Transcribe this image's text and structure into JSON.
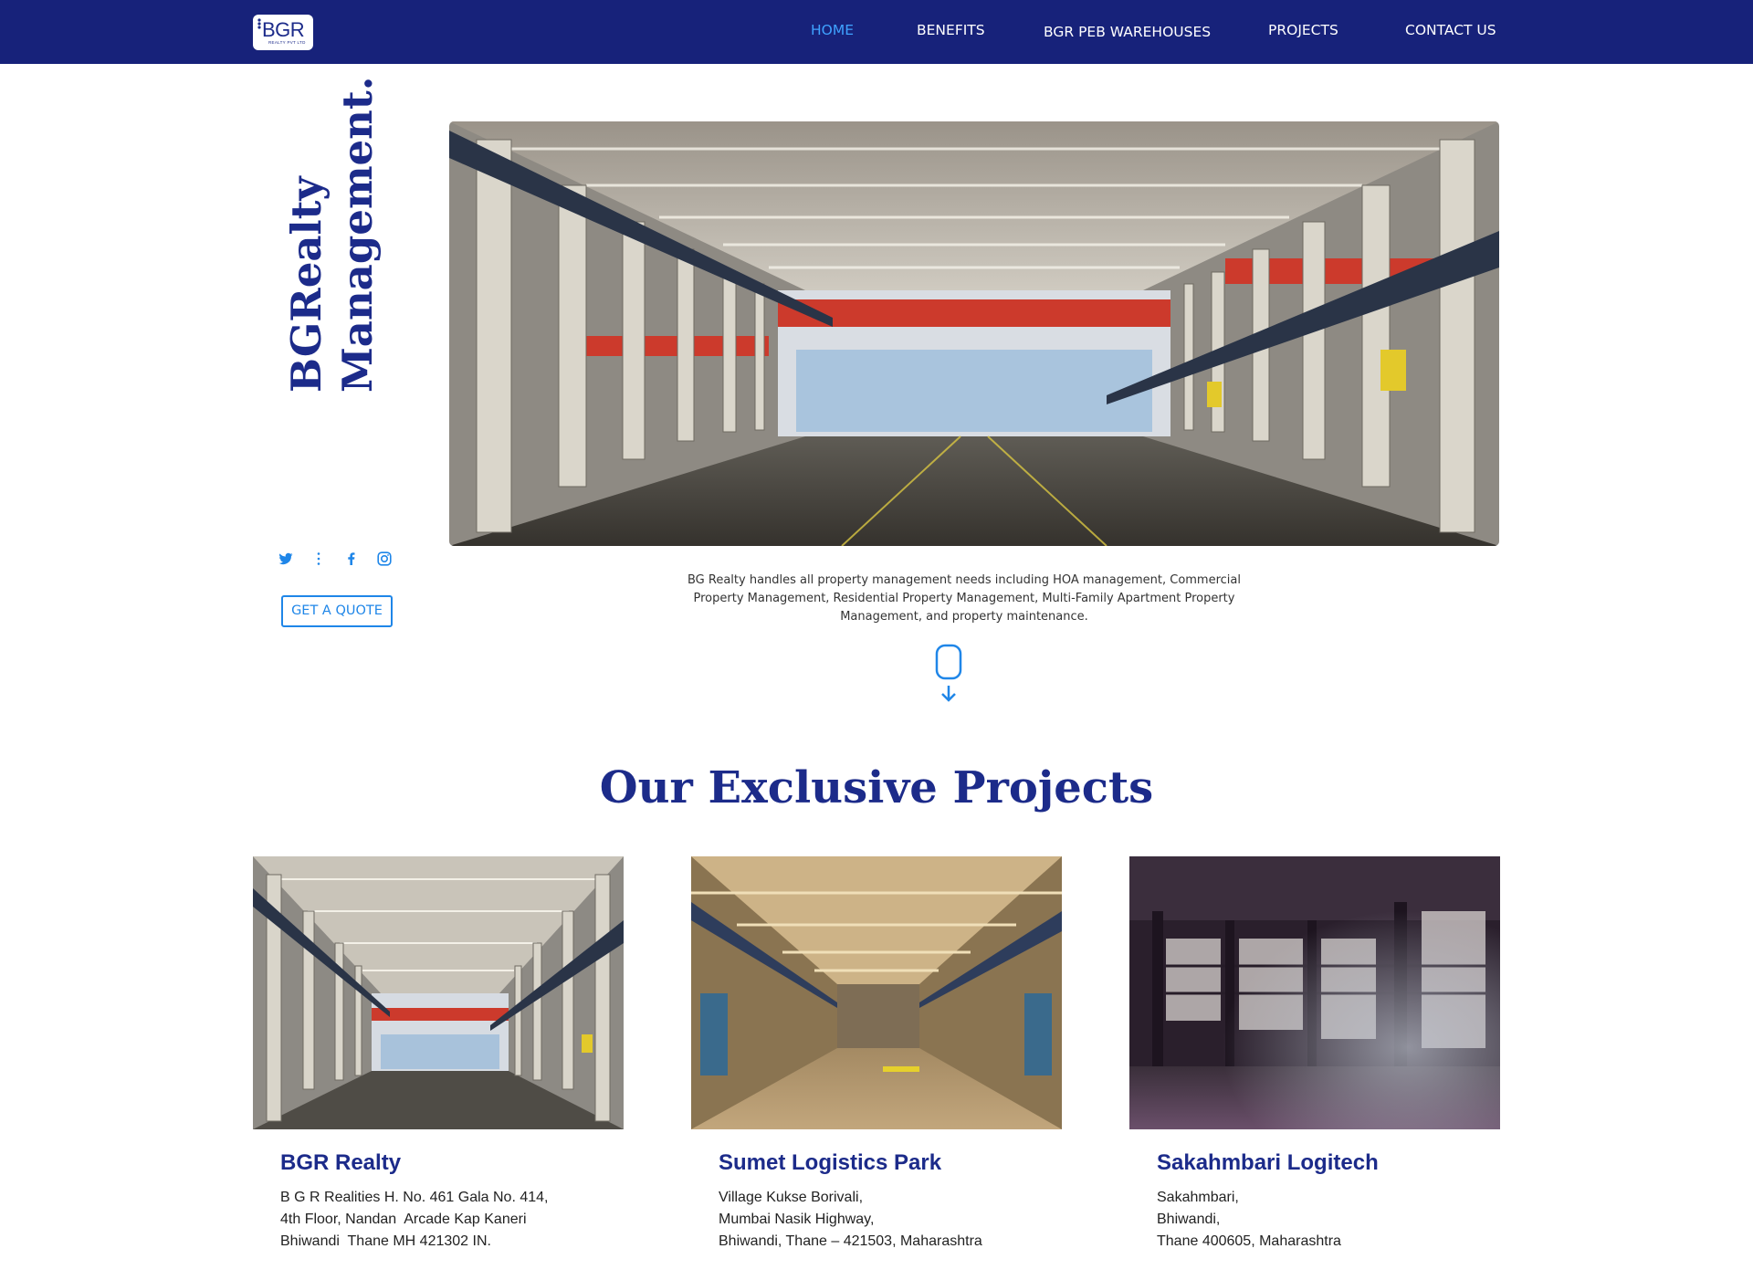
{
  "header": {
    "logo": {
      "text": "BGR",
      "sub": "REALTY PVT LTD"
    },
    "nav": [
      {
        "label": "HOME",
        "active": true
      },
      {
        "label": "BENEFITS",
        "active": false
      },
      {
        "label": "BGR PEB WAREHOUSES",
        "active": false
      },
      {
        "label": "PROJECTS",
        "active": false
      },
      {
        "label": "CONTACT US",
        "active": false
      }
    ]
  },
  "hero": {
    "title_line1": "BGRealty",
    "title_line2": "Management.",
    "social_icons": [
      "twitter-icon",
      "more-icon",
      "facebook-icon",
      "instagram-icon"
    ],
    "quote_button": "GET A QUOTE",
    "description": "BG Realty handles all property management needs including HOA management, Commercial Property Management, Residential Property Management, Multi-Family Apartment Property Management, and property maintenance."
  },
  "projects": {
    "title": "Our Exclusive Projects",
    "items": [
      {
        "name": "BGR Realty",
        "address": [
          "B G R Realities H. No. 461 Gala No. 414,",
          "4th Floor, Nandan  Arcade Kap Kaneri",
          "Bhiwandi  Thane MH 421302 IN."
        ]
      },
      {
        "name": "Sumet Logistics Park",
        "address": [
          "Village Kukse Borivali,",
          "Mumbai Nasik Highway,",
          "Bhiwandi, Thane – 421503, Maharashtra"
        ]
      },
      {
        "name": "Sakahmbari Logitech",
        "address": [
          "Sakahmbari,",
          "Bhiwandi,",
          "Thane 400605, Maharashtra"
        ]
      }
    ]
  },
  "colors": {
    "nav_bg": "#17227a",
    "brand": "#1c2b8a",
    "accent": "#1f86e8",
    "nav_active": "#3fa2ff"
  }
}
